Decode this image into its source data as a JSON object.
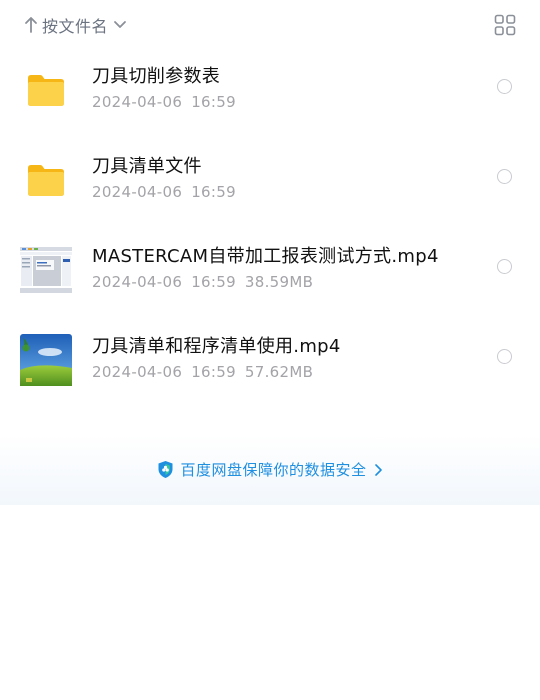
{
  "sort_bar": {
    "label": "按文件名",
    "icons": [
      "sort-up-arrow-icon",
      "chevron-down-icon",
      "grid-view-icon"
    ]
  },
  "files": [
    {
      "name": "刀具切削参数表",
      "date": "2024-04-06",
      "time": "16:59",
      "size": "",
      "icon": "folder-icon"
    },
    {
      "name": "刀具清单文件",
      "date": "2024-04-06",
      "time": "16:59",
      "size": "",
      "icon": "folder-icon"
    },
    {
      "name": "MASTERCAM自带加工报表测试方式.mp4",
      "date": "2024-04-06",
      "time": "16:59",
      "size": "38.59MB",
      "icon": "video-thumbnail-screen"
    },
    {
      "name": "刀具清单和程序清单使用.mp4",
      "date": "2024-04-06",
      "time": "16:59",
      "size": "57.62MB",
      "icon": "video-thumbnail-landscape"
    }
  ],
  "safety": {
    "text": "百度网盘保障你的数据安全",
    "icon": "shield-icon"
  },
  "colors": {
    "accent": "#1f8fe0",
    "folder": "#fcc934",
    "text_primary": "#111111",
    "text_secondary": "#a3a3a8"
  }
}
